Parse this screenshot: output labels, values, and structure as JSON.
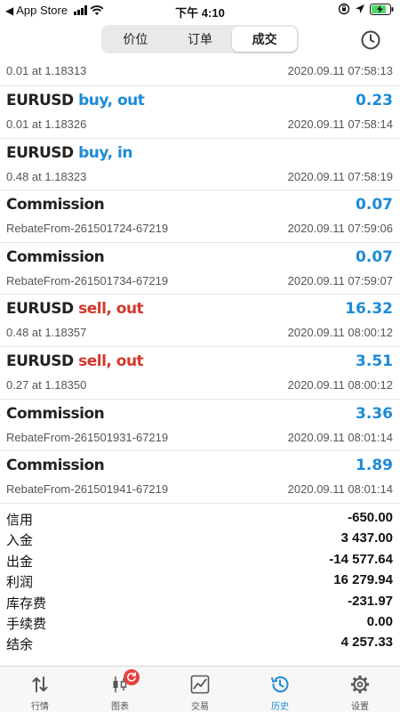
{
  "status_bar": {
    "back_app": "App Store",
    "time": "下午 4:10"
  },
  "nav": {
    "segments": [
      "价位",
      "订单",
      "成交"
    ],
    "active_segment": "成交",
    "history_icon": "clock-icon"
  },
  "deals": [
    {
      "sub": "0.01 at 1.18313",
      "time": "2020.09.11 07:58:13"
    },
    {
      "symbol": "EURUSD",
      "action": "buy, out",
      "amount": "0.23",
      "sub": "0.01 at 1.18326",
      "time": "2020.09.11 07:58:14"
    },
    {
      "symbol": "EURUSD",
      "action": "buy, in",
      "amount": "",
      "sub": "0.48 at 1.18323",
      "time": "2020.09.11 07:58:19"
    },
    {
      "symbol": "Commission",
      "action": "",
      "amount": "0.07",
      "sub": "RebateFrom-261501724-67219",
      "time": "2020.09.11 07:59:06"
    },
    {
      "symbol": "Commission",
      "action": "",
      "amount": "0.07",
      "sub": "RebateFrom-261501734-67219",
      "time": "2020.09.11 07:59:07"
    },
    {
      "symbol": "EURUSD",
      "action": "sell, out",
      "amount": "16.32",
      "sub": "0.48 at 1.18357",
      "time": "2020.09.11 08:00:12"
    },
    {
      "symbol": "EURUSD",
      "action": "sell, out",
      "amount": "3.51",
      "sub": "0.27 at 1.18350",
      "time": "2020.09.11 08:00:12"
    },
    {
      "symbol": "Commission",
      "action": "",
      "amount": "3.36",
      "sub": "RebateFrom-261501931-67219",
      "time": "2020.09.11 08:01:14"
    },
    {
      "symbol": "Commission",
      "action": "",
      "amount": "1.89",
      "sub": "RebateFrom-261501941-67219",
      "time": "2020.09.11 08:01:14"
    }
  ],
  "summary": [
    {
      "label": "信用",
      "value": "-650.00"
    },
    {
      "label": "入金",
      "value": "3 437.00"
    },
    {
      "label": "出金",
      "value": "-14 577.64"
    },
    {
      "label": "利润",
      "value": "16 279.94"
    },
    {
      "label": "库存费",
      "value": "-231.97"
    },
    {
      "label": "手续费",
      "value": "0.00"
    },
    {
      "label": "结余",
      "value": "4 257.33"
    }
  ],
  "tabs": [
    {
      "label": "行情",
      "icon": "arrows-updown-icon"
    },
    {
      "label": "图表",
      "icon": "candlestick-icon"
    },
    {
      "label": "交易",
      "icon": "chart-line-icon"
    },
    {
      "label": "历史",
      "icon": "history-icon"
    },
    {
      "label": "设置",
      "icon": "gear-icon"
    }
  ],
  "active_tab": "历史",
  "colors": {
    "accent_blue": "#1e8bd8",
    "sell_red": "#d4372b",
    "badge_red": "#e8403a"
  }
}
